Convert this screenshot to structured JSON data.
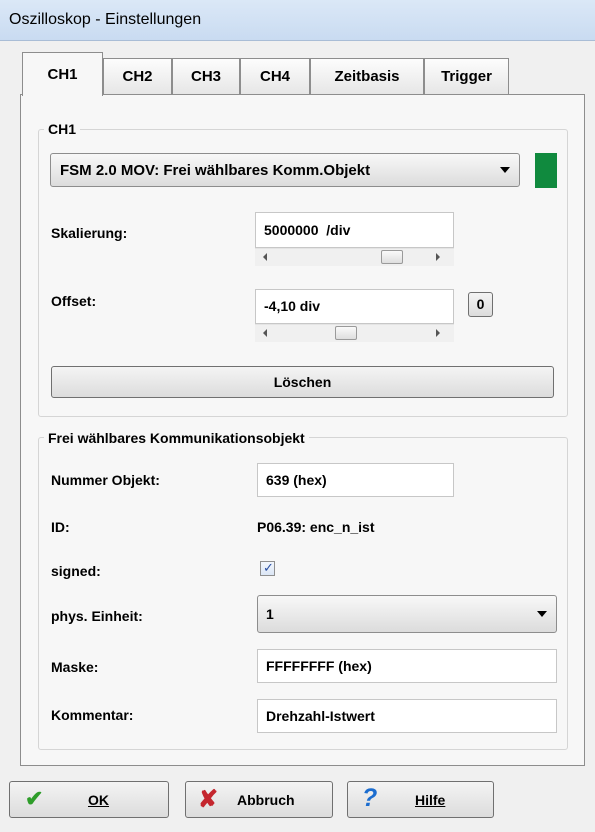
{
  "window": {
    "title": "Oszilloskop - Einstellungen"
  },
  "tabs": [
    "CH1",
    "CH2",
    "CH3",
    "CH4",
    "Zeitbasis",
    "Trigger"
  ],
  "ch1_group": {
    "title": "CH1",
    "signal_select": "FSM 2.0 MOV: Frei wählbares Komm.Objekt",
    "color": "#108a3e",
    "scaling_label": "Skalierung:",
    "scaling_value": "5000000  /div",
    "offset_label": "Offset:",
    "offset_value": "-4,10 div",
    "zero_button": "0",
    "clear_button": "Löschen"
  },
  "comm_group": {
    "title": "Frei wählbares Kommunikationsobjekt",
    "number_label": "Nummer Objekt:",
    "number_value": "639 (hex)",
    "id_label": "ID:",
    "id_value": "P06.39: enc_n_ist",
    "signed_label": "signed:",
    "signed_checked": true,
    "unit_label": "phys. Einheit:",
    "unit_value": "1",
    "mask_label": "Maske:",
    "mask_value": "FFFFFFFF (hex)",
    "comment_label": "Kommentar:",
    "comment_value": "Drehzahl-Istwert"
  },
  "buttons": {
    "ok_label": "OK",
    "cancel_label": "Abbruch",
    "help_label": "Hilfe"
  }
}
